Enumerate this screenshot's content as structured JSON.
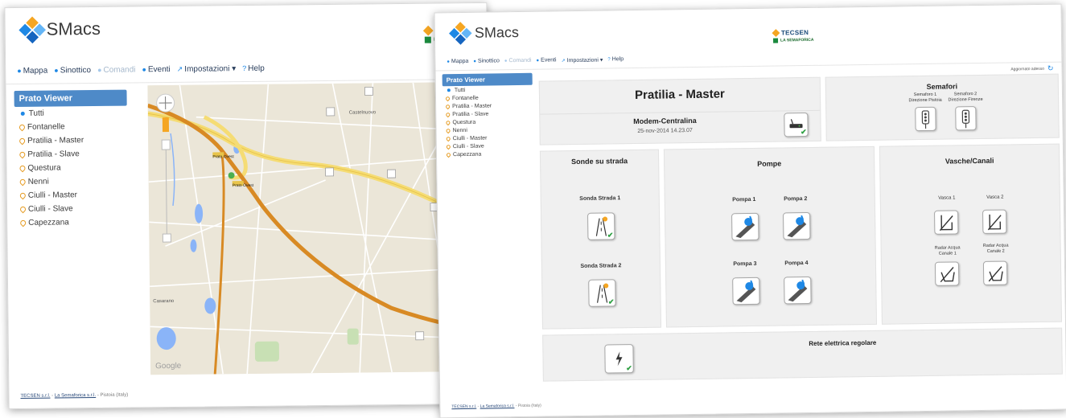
{
  "app": {
    "name": "SMacs"
  },
  "brand": {
    "company": "TECSEN",
    "partner": "LA SEMAFORICA"
  },
  "nav": {
    "mappa": "Mappa",
    "sinottico": "Sinottico",
    "comandi": "Comandi",
    "eventi": "Eventi",
    "impostazioni": "Impostazioni",
    "help": "Help"
  },
  "sidebar": {
    "title": "Prato Viewer",
    "items": [
      "Tutti",
      "Fontanelle",
      "Pratilia - Master",
      "Pratilia - Slave",
      "Questura",
      "Nenni",
      "Ciulli - Master",
      "Ciulli - Slave",
      "Capezzana"
    ]
  },
  "map": {
    "attribution": "Google",
    "place_labels": [
      "Prato Ovest",
      "Prato Ovest",
      "Castelnuovo",
      "Casarano"
    ]
  },
  "footer": {
    "company": "TECSEN s.r.l.",
    "partner": "La Semaforica s.r.l.",
    "location": "- Pistoia (Italy)"
  },
  "synoptic": {
    "station_title": "Pratilia - Master",
    "refresh": "Aggiornato adesso",
    "modem": {
      "title": "Modem-Centralina",
      "datetime": "25-nov-2014 14.23.07"
    },
    "semafori": {
      "title": "Semafori",
      "items": [
        {
          "line1": "Semaforo 1",
          "line2": "Direzione Pistoia"
        },
        {
          "line1": "Semaforo 2",
          "line2": "Direzione Firenze"
        }
      ]
    },
    "sonde": {
      "title": "Sonde su strada",
      "items": [
        "Sonda Strada 1",
        "Sonda Strada 2"
      ]
    },
    "pompe": {
      "title": "Pompe",
      "items": [
        "Pompa 1",
        "Pompa 2",
        "Pompa 3",
        "Pompa 4"
      ]
    },
    "vasche": {
      "title": "Vasche/Canali",
      "items": [
        "Vasca 1",
        "Vasca 2"
      ],
      "radar": [
        {
          "line1": "Radar Acqua",
          "line2": "Canale 1"
        },
        {
          "line1": "Radar Acqua",
          "line2": "Canale 2"
        }
      ]
    },
    "rete": {
      "title": "Rete elettrica regolare"
    }
  },
  "colors": {
    "accent": "#4e8ac8",
    "ok": "#2ea043",
    "road": "#d88a24",
    "map_bg": "#ebe6d8"
  }
}
